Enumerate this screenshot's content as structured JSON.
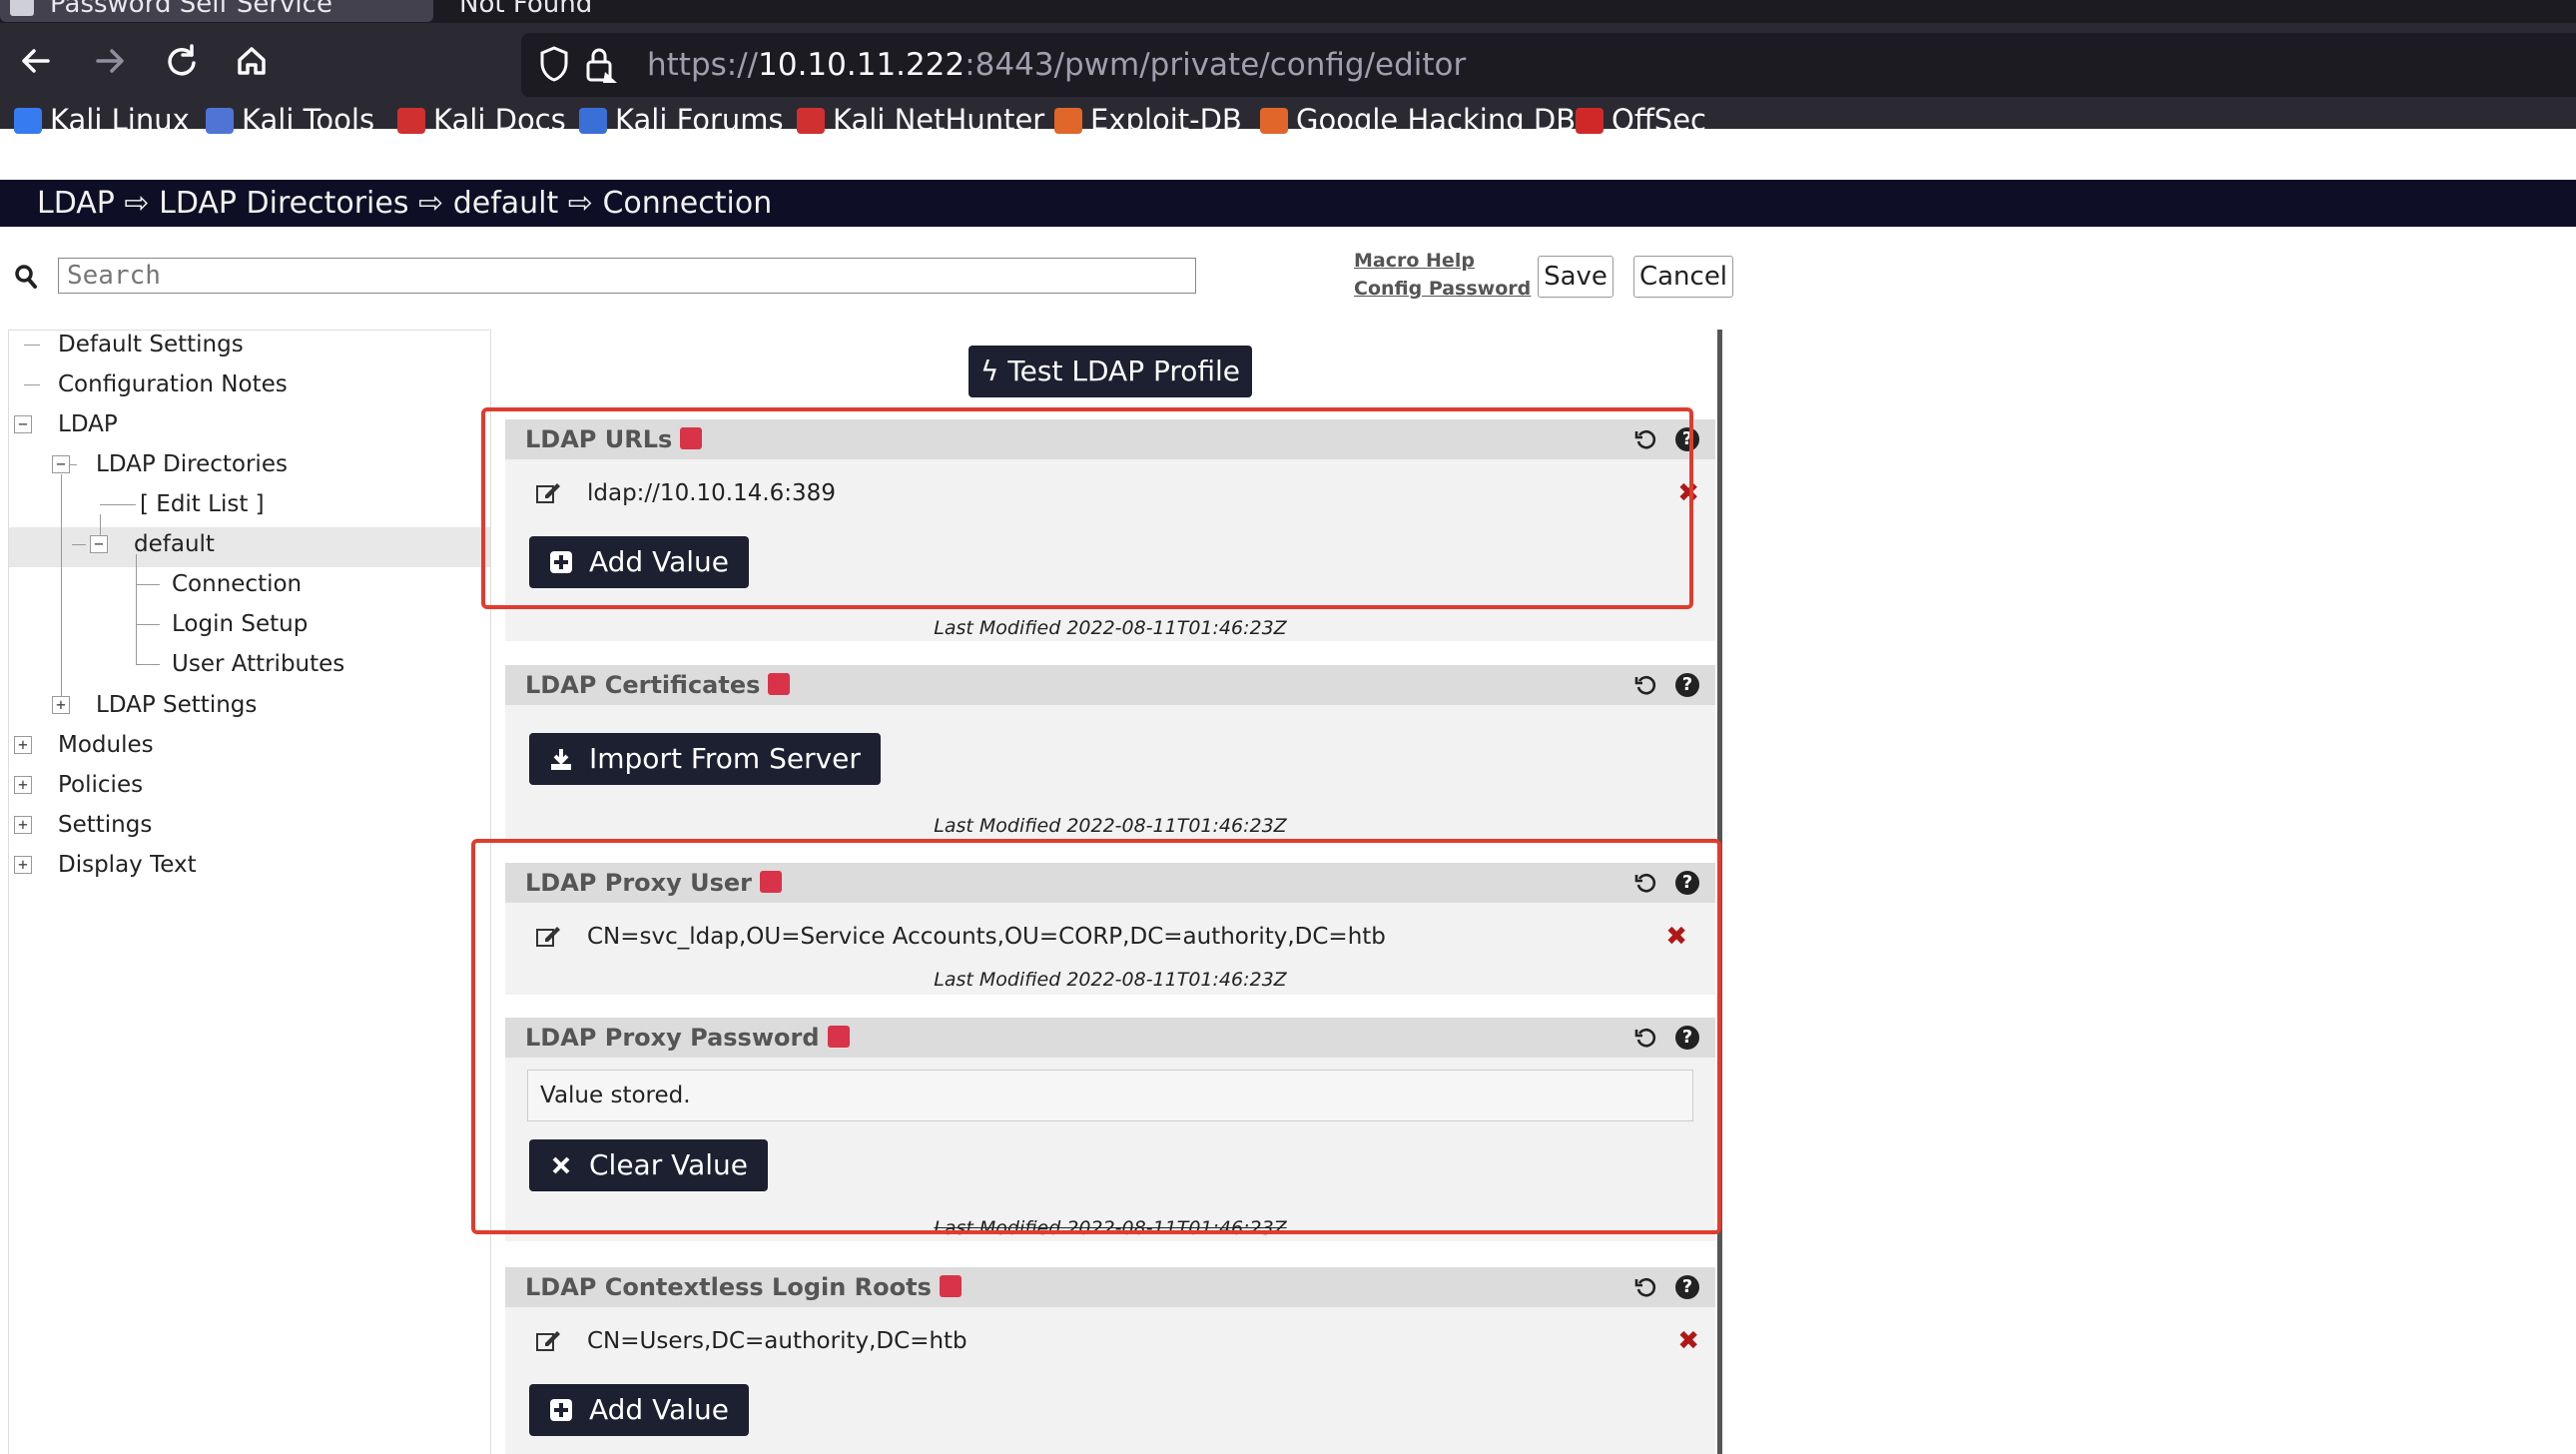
{
  "browser": {
    "tabs": [
      {
        "label": "Password Self Service"
      },
      {
        "label": "Not Found"
      }
    ],
    "url": {
      "scheme": "https://",
      "host": "10.10.11.222",
      "rest": ":8443/pwm/private/config/editor"
    },
    "bookmarks": [
      {
        "label": "Kali Linux",
        "color": "#367bf0"
      },
      {
        "label": "Kali Tools",
        "color": "#4f74d6"
      },
      {
        "label": "Kali Docs",
        "color": "#d03030"
      },
      {
        "label": "Kali Forums",
        "color": "#3a6fd8"
      },
      {
        "label": "Kali NetHunter",
        "color": "#d03030"
      },
      {
        "label": "Exploit-DB",
        "color": "#e0662a"
      },
      {
        "label": "Google Hacking DB",
        "color": "#e0662a"
      },
      {
        "label": "OffSec",
        "color": "#d02828"
      }
    ]
  },
  "header": {
    "breadcrumb": "LDAP ⇨ LDAP Directories ⇨ default ⇨ Connection"
  },
  "toolbar": {
    "search_placeholder": "Search",
    "macro_help": "Macro Help",
    "config_password": "Config Password",
    "save": "Save",
    "cancel": "Cancel"
  },
  "tree": {
    "default_settings": "Default Settings",
    "configuration_notes": "Configuration Notes",
    "ldap": "LDAP",
    "ldap_directories": "LDAP Directories",
    "edit_list": "[ Edit List ]",
    "default": "default",
    "connection": "Connection",
    "login_setup": "Login Setup",
    "user_attributes": "User Attributes",
    "ldap_settings": "LDAP Settings",
    "modules": "Modules",
    "policies": "Policies",
    "settings": "Settings",
    "display_text": "Display Text"
  },
  "main": {
    "test_button": "Test LDAP Profile",
    "ldap_urls": {
      "title": "LDAP URLs",
      "value": "ldap://10.10.14.6:389",
      "add_button": "Add Value",
      "last_modified": "Last Modified 2022-08-11T01:46:23Z"
    },
    "ldap_certificates": {
      "title": "LDAP Certificates",
      "import_button": "Import From Server",
      "last_modified": "Last Modified 2022-08-11T01:46:23Z"
    },
    "ldap_proxy_user": {
      "title": "LDAP Proxy User",
      "value": "CN=svc_ldap,OU=Service Accounts,OU=CORP,DC=authority,DC=htb",
      "last_modified": "Last Modified 2022-08-11T01:46:23Z"
    },
    "ldap_proxy_password": {
      "title": "LDAP Proxy Password",
      "stored_text": "Value stored.",
      "clear_button": "Clear Value",
      "last_modified": "Last Modified 2022-08-11T01:46:23Z"
    },
    "ldap_contextless_login_roots": {
      "title": "LDAP Contextless Login Roots",
      "value": "CN=Users,DC=authority,DC=htb",
      "add_button": "Add Value"
    }
  },
  "colors": {
    "header_bar": "#0e0e26",
    "button_dark": "#1c2030",
    "modified_flag": "#d9334a",
    "annotation_red": "#e03c2e"
  }
}
